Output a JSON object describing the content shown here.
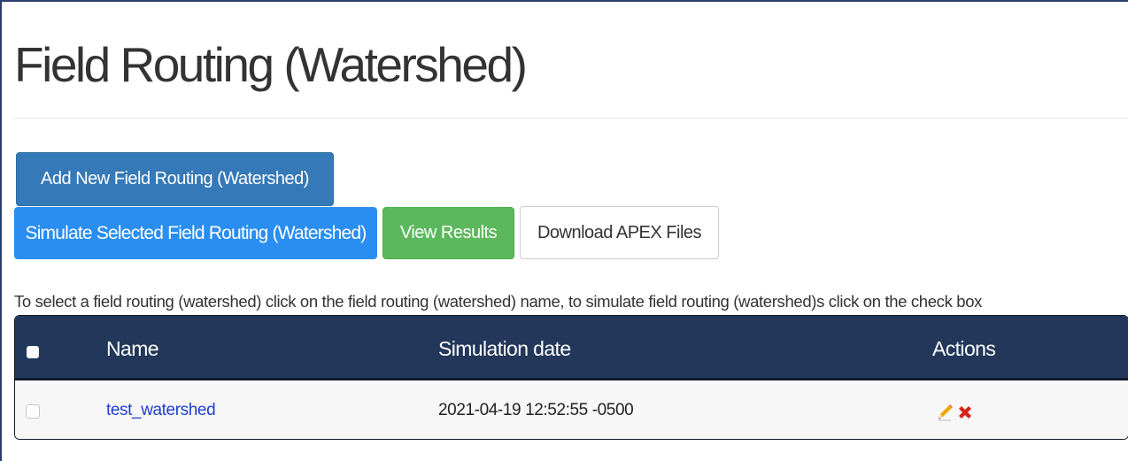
{
  "page": {
    "title": "Field Routing (Watershed)"
  },
  "buttons": {
    "add_label": "Add New Field Routing (Watershed)",
    "simulate_label": "Simulate Selected Field Routing (Watershed)",
    "view_results_label": "View Results",
    "download_label": "Download APEX Files"
  },
  "instructions": "To select a field routing (watershed) click on the field routing (watershed) name, to simulate field routing (watershed)s click on the check box",
  "table": {
    "columns": [
      "",
      "Name",
      "Simulation date",
      "Actions"
    ],
    "rows": [
      {
        "checked": false,
        "name": "test_watershed",
        "simulation_date": "2021-04-19 12:52:55 -0500",
        "actions": [
          "pencil-edit-icon",
          "red-x-delete-icon"
        ]
      }
    ]
  },
  "colors": {
    "primary": "#3579b8",
    "info": "#2a8ef0",
    "success": "#5cb85c",
    "table_header": "#22375a",
    "link": "#1f3fcf",
    "delete": "#d9241c",
    "edit": "#f0a500"
  }
}
